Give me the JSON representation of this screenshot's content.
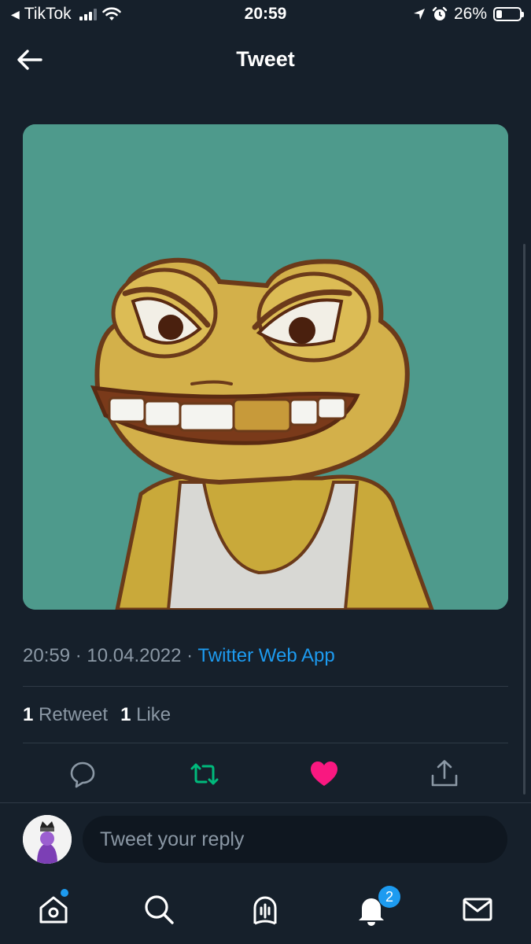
{
  "status_bar": {
    "back_app": "TikTok",
    "time": "20:59",
    "battery": "26%",
    "battery_level": 0.26
  },
  "header": {
    "title": "Tweet"
  },
  "tweet": {
    "meta_time": "20:59 · 10.04.2022 · ",
    "meta_app": "Twitter Web App",
    "retweet_count": "1",
    "retweet_label": "Retweet",
    "like_count": "1",
    "like_label": "Like"
  },
  "actions": {
    "reply_icon": "reply-icon",
    "retweet_icon": "retweet-icon",
    "like_icon": "heart-icon",
    "share_icon": "share-icon",
    "retweet_color": "#00ba7c",
    "like_color": "#f91880"
  },
  "reply": {
    "placeholder": "Tweet your reply"
  },
  "navbar": {
    "notifications_count": "2",
    "items": [
      "home-icon",
      "search-icon",
      "spaces-icon",
      "notifications-icon",
      "messages-icon"
    ]
  },
  "colors": {
    "background": "#16202b",
    "accent": "#1d9bf0",
    "image_bg": "#4e9a8c"
  }
}
